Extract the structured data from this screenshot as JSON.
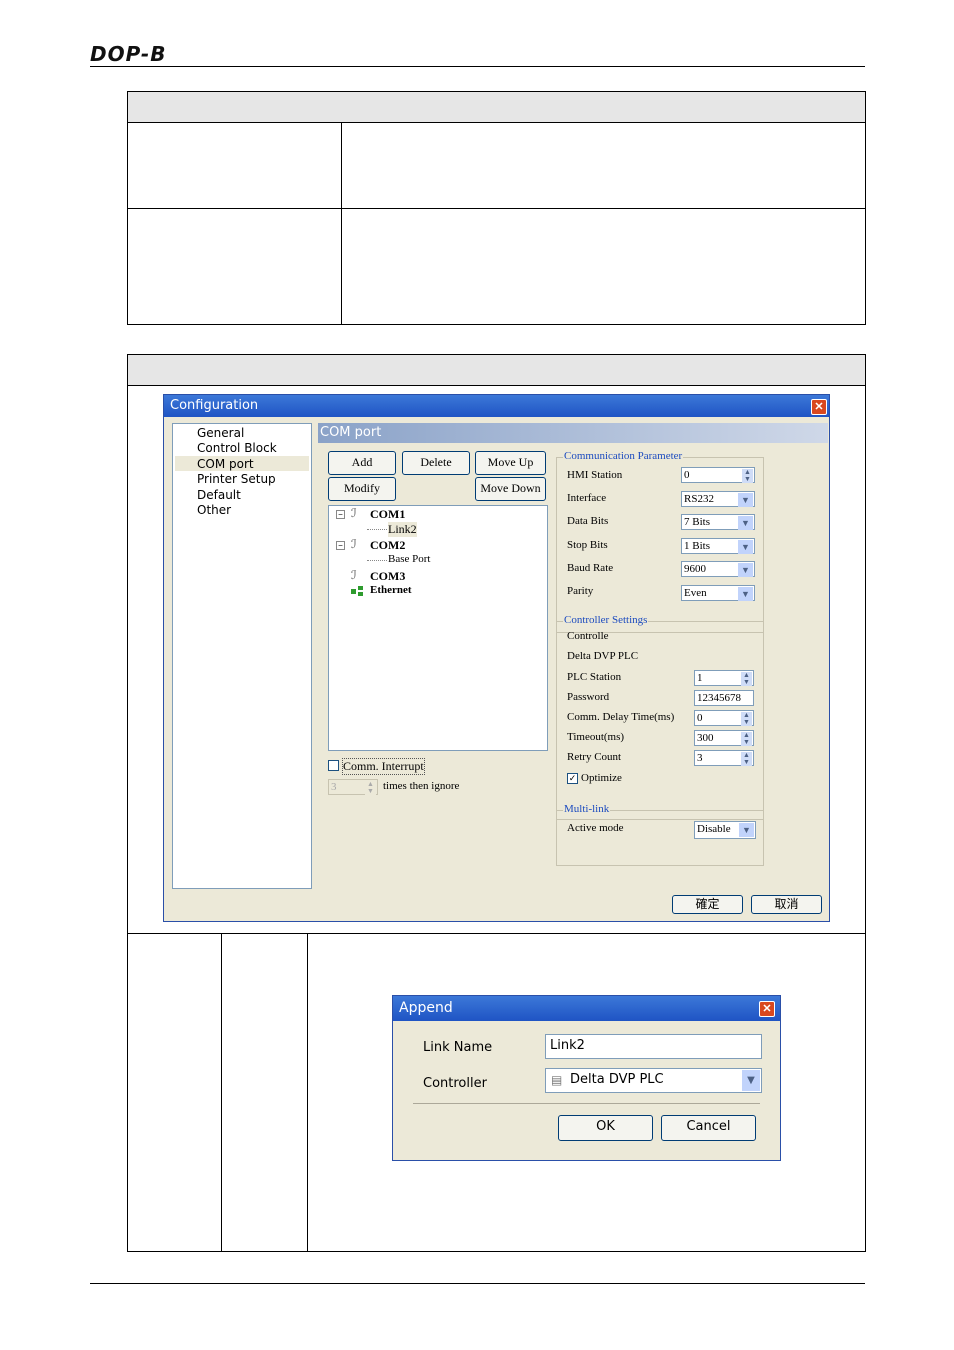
{
  "header": {
    "logo": "DOP-B"
  },
  "config_window": {
    "title": "Configuration",
    "close": "✕",
    "nav": [
      "General",
      "Control Block",
      "COM port",
      "Printer Setup",
      "Default",
      "Other"
    ],
    "panel_title": "COM port",
    "buttons": {
      "add": "Add",
      "delete": "Delete",
      "move_up": "Move Up",
      "modify": "Modify",
      "move_down": "Move Down"
    },
    "tree": {
      "com1": "COM1",
      "link2": "Link2",
      "com2": "COM2",
      "base_port": "Base Port",
      "com3": "COM3",
      "ethernet": "Ethernet"
    },
    "comm_interrupt": {
      "label": "Comm. Interrupt",
      "checked": false,
      "count": "3",
      "suffix": "times then ignore"
    },
    "comm_param": {
      "group": "Communication Parameter",
      "hmi_station": {
        "label": "HMI Station",
        "value": "0"
      },
      "interface": {
        "label": "Interface",
        "value": "RS232"
      },
      "data_bits": {
        "label": "Data Bits",
        "value": "7 Bits"
      },
      "stop_bits": {
        "label": "Stop Bits",
        "value": "1 Bits"
      },
      "baud_rate": {
        "label": "Baud Rate",
        "value": "9600"
      },
      "parity": {
        "label": "Parity",
        "value": "Even"
      }
    },
    "controller": {
      "group": "Controller Settings",
      "controller_label": "Controlle",
      "controller_value": "Delta DVP PLC",
      "plc_station": {
        "label": "PLC Station",
        "value": "1"
      },
      "password": {
        "label": "Password",
        "value": "12345678"
      },
      "comm_delay": {
        "label": "Comm. Delay Time(ms)",
        "value": "0"
      },
      "timeout": {
        "label": "Timeout(ms)",
        "value": "300"
      },
      "retry": {
        "label": "Retry Count",
        "value": "3"
      },
      "optimize": {
        "label": "Optimize",
        "checked": true
      }
    },
    "multilink": {
      "group": "Multi-link",
      "active_mode": {
        "label": "Active mode",
        "value": "Disable"
      }
    },
    "ok": "確定",
    "cancel": "取消"
  },
  "append_dialog": {
    "title": "Append",
    "close": "✕",
    "link_name_label": "Link Name",
    "link_name_value": "Link2",
    "controller_label": "Controller",
    "controller_value": "Delta DVP PLC",
    "ok": "OK",
    "cancel": "Cancel"
  }
}
